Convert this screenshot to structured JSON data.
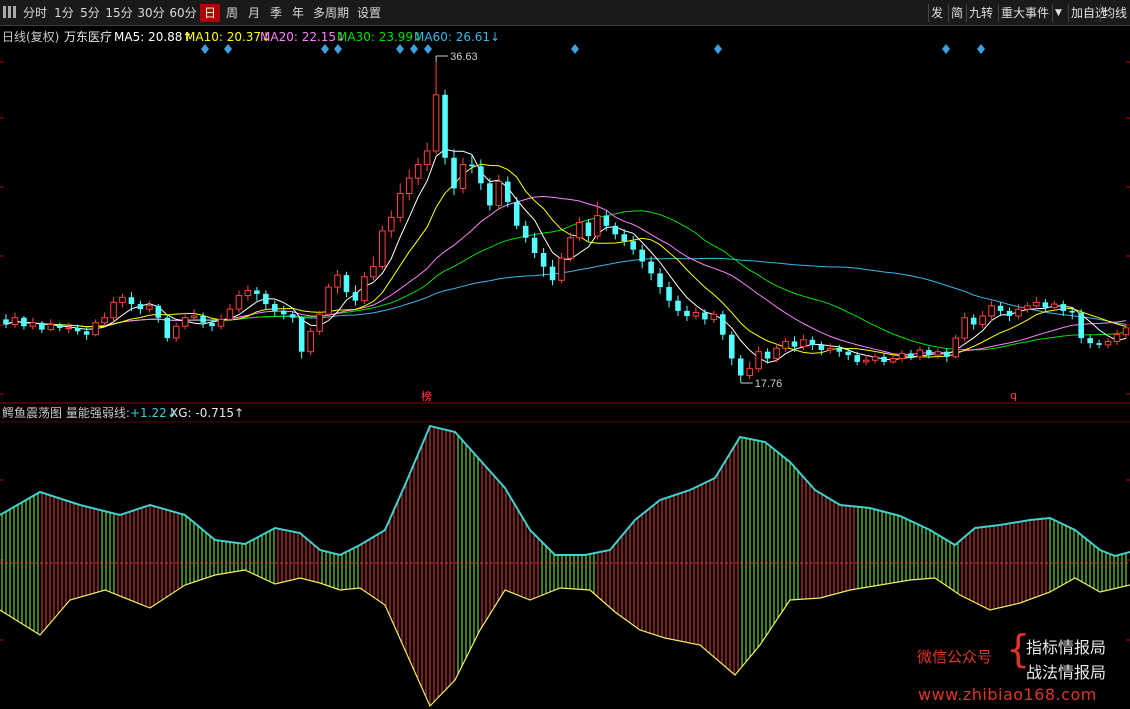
{
  "toolbar": {
    "periods": [
      "分时",
      "1分",
      "5分",
      "15分",
      "30分",
      "60分",
      "日",
      "周",
      "月",
      "季",
      "年",
      "多周期",
      "设置"
    ],
    "active": "日",
    "right_buttons": [
      "发",
      "简",
      "九转",
      "重大事件",
      "加自选",
      "均线"
    ]
  },
  "main_info": {
    "title": "日线(复权)",
    "stock": "万东医疗",
    "ma5": "MA5: 20.88↑",
    "ma10": "MA10: 20.37↓",
    "ma20": "MA20: 22.15↓",
    "ma30": "MA30: 23.99↓",
    "ma60": "MA60: 26.61↓"
  },
  "annotations": {
    "high": "36.63",
    "low": "17.76",
    "mark1": "榜",
    "mark2": "q"
  },
  "sub_info": {
    "title": "鳄鱼震荡图 量能强弱线:",
    "value1": "+1.22↓",
    "xg": "XG: -0.715↑"
  },
  "watermark": {
    "wechat": "微信公众号",
    "brace": "{",
    "line1": "指标情报局",
    "line2": "战法情报局",
    "url": "www.zhibiao168.com"
  },
  "colors": {
    "up": "#ff4040",
    "down": "#54ffff",
    "ma5": "#ffffff",
    "ma10": "#ffff00",
    "ma20": "#ff80ff",
    "ma30": "#00e000",
    "ma60": "#3fb4e6",
    "osc_red": "#c83232",
    "osc_green": "#6ad232",
    "osc_top": "#3fd0d0",
    "osc_bottom": "#f0f060"
  },
  "chart_data": {
    "type": "candlestick",
    "price_range": [
      17.76,
      36.63
    ],
    "candles": [
      [
        21.5,
        21.2,
        21.8,
        21.0
      ],
      [
        21.2,
        21.6,
        21.9,
        21.0
      ],
      [
        21.6,
        21.1,
        21.7,
        20.9
      ],
      [
        21.1,
        21.3,
        21.6,
        20.9
      ],
      [
        21.3,
        20.9,
        21.4,
        20.7
      ],
      [
        20.9,
        21.2,
        21.5,
        20.8
      ],
      [
        21.2,
        21.0,
        21.3,
        20.8
      ],
      [
        21.0,
        21.0,
        21.3,
        20.7
      ],
      [
        21.0,
        20.8,
        21.2,
        20.6
      ],
      [
        20.8,
        20.6,
        21.0,
        20.3
      ],
      [
        20.6,
        21.3,
        21.5,
        20.5
      ],
      [
        21.3,
        21.6,
        21.9,
        21.1
      ],
      [
        21.6,
        22.5,
        22.8,
        21.4
      ],
      [
        22.5,
        22.8,
        23.0,
        22.2
      ],
      [
        22.8,
        22.4,
        23.1,
        22.0
      ],
      [
        22.4,
        22.1,
        22.6,
        21.8
      ],
      [
        22.1,
        22.3,
        22.6,
        21.9
      ],
      [
        22.3,
        21.6,
        22.4,
        21.3
      ],
      [
        21.6,
        20.4,
        21.8,
        20.2
      ],
      [
        20.4,
        21.1,
        21.3,
        20.2
      ],
      [
        21.1,
        21.6,
        21.9,
        20.9
      ],
      [
        21.6,
        21.7,
        22.1,
        21.4
      ],
      [
        21.7,
        21.3,
        21.9,
        21.0
      ],
      [
        21.3,
        21.1,
        21.5,
        20.8
      ],
      [
        21.1,
        21.5,
        21.8,
        20.9
      ],
      [
        21.5,
        22.1,
        22.4,
        21.4
      ],
      [
        22.1,
        22.9,
        23.2,
        21.9
      ],
      [
        22.9,
        23.2,
        23.5,
        22.6
      ],
      [
        23.2,
        23.0,
        23.4,
        22.6
      ],
      [
        23.0,
        22.4,
        23.2,
        22.1
      ],
      [
        22.4,
        22.0,
        22.6,
        21.7
      ],
      [
        22.0,
        21.8,
        22.3,
        21.5
      ],
      [
        21.8,
        21.6,
        22.0,
        21.3
      ],
      [
        21.6,
        19.6,
        21.7,
        19.2
      ],
      [
        19.6,
        20.8,
        21.0,
        19.4
      ],
      [
        20.8,
        21.8,
        22.0,
        20.6
      ],
      [
        21.8,
        23.4,
        23.6,
        21.6
      ],
      [
        23.4,
        24.1,
        24.4,
        23.0
      ],
      [
        24.1,
        23.1,
        24.3,
        22.8
      ],
      [
        23.1,
        22.6,
        23.5,
        22.3
      ],
      [
        22.6,
        24.0,
        24.3,
        22.4
      ],
      [
        24.0,
        24.6,
        25.2,
        23.8
      ],
      [
        24.6,
        26.7,
        27.0,
        24.4
      ],
      [
        26.7,
        27.5,
        27.9,
        26.3
      ],
      [
        27.5,
        28.9,
        29.5,
        27.2
      ],
      [
        28.9,
        29.8,
        30.3,
        28.5
      ],
      [
        29.8,
        30.6,
        31.0,
        29.4
      ],
      [
        30.6,
        31.4,
        31.9,
        30.2
      ],
      [
        31.4,
        34.7,
        36.63,
        31.2
      ],
      [
        34.7,
        31.0,
        35.0,
        30.6
      ],
      [
        31.0,
        29.2,
        31.5,
        28.8
      ],
      [
        29.2,
        30.6,
        31.0,
        28.9
      ],
      [
        30.6,
        30.5,
        31.2,
        30.1
      ],
      [
        30.5,
        29.5,
        30.9,
        29.1
      ],
      [
        29.5,
        28.2,
        29.8,
        27.9
      ],
      [
        28.2,
        29.6,
        30.0,
        28.0
      ],
      [
        29.6,
        28.4,
        29.9,
        28.1
      ],
      [
        28.4,
        27.0,
        28.7,
        26.8
      ],
      [
        27.0,
        26.3,
        27.3,
        26.0
      ],
      [
        26.3,
        25.4,
        26.6,
        25.1
      ],
      [
        25.4,
        24.6,
        25.7,
        24.0
      ],
      [
        24.6,
        23.8,
        25.0,
        23.5
      ],
      [
        23.8,
        25.1,
        25.4,
        23.6
      ],
      [
        25.1,
        26.3,
        26.6,
        24.9
      ],
      [
        26.3,
        27.2,
        27.5,
        26.1
      ],
      [
        27.2,
        26.4,
        27.4,
        26.1
      ],
      [
        26.4,
        27.6,
        28.4,
        26.2
      ],
      [
        27.6,
        27.0,
        27.9,
        26.7
      ],
      [
        27.0,
        26.5,
        27.2,
        26.2
      ],
      [
        26.5,
        26.1,
        26.8,
        25.8
      ],
      [
        26.1,
        25.6,
        26.4,
        25.3
      ],
      [
        25.6,
        24.9,
        25.9,
        24.5
      ],
      [
        24.9,
        24.2,
        25.2,
        23.8
      ],
      [
        24.2,
        23.4,
        24.5,
        23.0
      ],
      [
        23.4,
        22.6,
        23.7,
        22.2
      ],
      [
        22.6,
        22.0,
        22.9,
        21.7
      ],
      [
        22.0,
        21.7,
        22.3,
        21.4
      ],
      [
        21.7,
        21.9,
        22.2,
        21.5
      ],
      [
        21.9,
        21.5,
        22.1,
        21.2
      ],
      [
        21.5,
        21.8,
        22.0,
        21.3
      ],
      [
        21.8,
        20.6,
        22.0,
        20.3
      ],
      [
        20.6,
        19.2,
        20.8,
        18.8
      ],
      [
        19.2,
        18.2,
        19.4,
        17.76
      ],
      [
        18.2,
        18.6,
        19.0,
        18.0
      ],
      [
        18.6,
        19.6,
        19.9,
        18.4
      ],
      [
        19.6,
        19.2,
        19.8,
        18.9
      ],
      [
        19.2,
        19.8,
        20.1,
        19.0
      ],
      [
        19.8,
        20.2,
        20.4,
        19.6
      ],
      [
        20.2,
        19.9,
        20.5,
        19.6
      ],
      [
        19.9,
        20.3,
        20.6,
        19.7
      ],
      [
        20.3,
        20.0,
        20.5,
        19.7
      ],
      [
        20.0,
        19.7,
        20.2,
        19.4
      ],
      [
        19.7,
        19.8,
        20.1,
        19.5
      ],
      [
        19.8,
        19.6,
        20.0,
        19.3
      ],
      [
        19.6,
        19.4,
        19.8,
        19.1
      ],
      [
        19.4,
        19.0,
        19.6,
        18.8
      ],
      [
        19.0,
        19.1,
        19.4,
        18.8
      ],
      [
        19.1,
        19.3,
        19.5,
        18.9
      ],
      [
        19.3,
        19.0,
        19.5,
        18.8
      ],
      [
        19.0,
        19.2,
        19.4,
        18.9
      ],
      [
        19.2,
        19.5,
        19.7,
        19.0
      ],
      [
        19.5,
        19.3,
        19.7,
        19.1
      ],
      [
        19.3,
        19.7,
        19.9,
        19.1
      ],
      [
        19.7,
        19.4,
        19.9,
        19.2
      ],
      [
        19.4,
        19.6,
        19.8,
        19.2
      ],
      [
        19.6,
        19.3,
        19.8,
        19.0
      ],
      [
        19.3,
        20.4,
        20.6,
        19.2
      ],
      [
        20.4,
        21.6,
        21.9,
        20.2
      ],
      [
        21.6,
        21.2,
        21.8,
        20.9
      ],
      [
        21.2,
        21.7,
        22.0,
        21.0
      ],
      [
        21.7,
        22.3,
        22.6,
        21.4
      ],
      [
        22.3,
        22.0,
        22.5,
        21.7
      ],
      [
        22.0,
        21.7,
        22.2,
        21.4
      ],
      [
        21.7,
        22.1,
        22.4,
        21.5
      ],
      [
        22.1,
        22.3,
        22.5,
        21.9
      ],
      [
        22.3,
        22.5,
        22.8,
        22.1
      ],
      [
        22.5,
        22.2,
        22.7,
        21.9
      ],
      [
        22.2,
        22.4,
        22.6,
        22.0
      ],
      [
        22.4,
        22.0,
        22.6,
        21.7
      ],
      [
        22.0,
        21.9,
        22.2,
        21.5
      ],
      [
        21.9,
        20.4,
        22.1,
        20.1
      ],
      [
        20.4,
        20.1,
        20.6,
        19.8
      ],
      [
        20.1,
        20.0,
        20.3,
        19.8
      ],
      [
        20.0,
        20.2,
        20.4,
        19.8
      ],
      [
        20.2,
        20.6,
        20.9,
        20.0
      ],
      [
        20.6,
        21.0,
        21.2,
        20.4
      ]
    ]
  }
}
